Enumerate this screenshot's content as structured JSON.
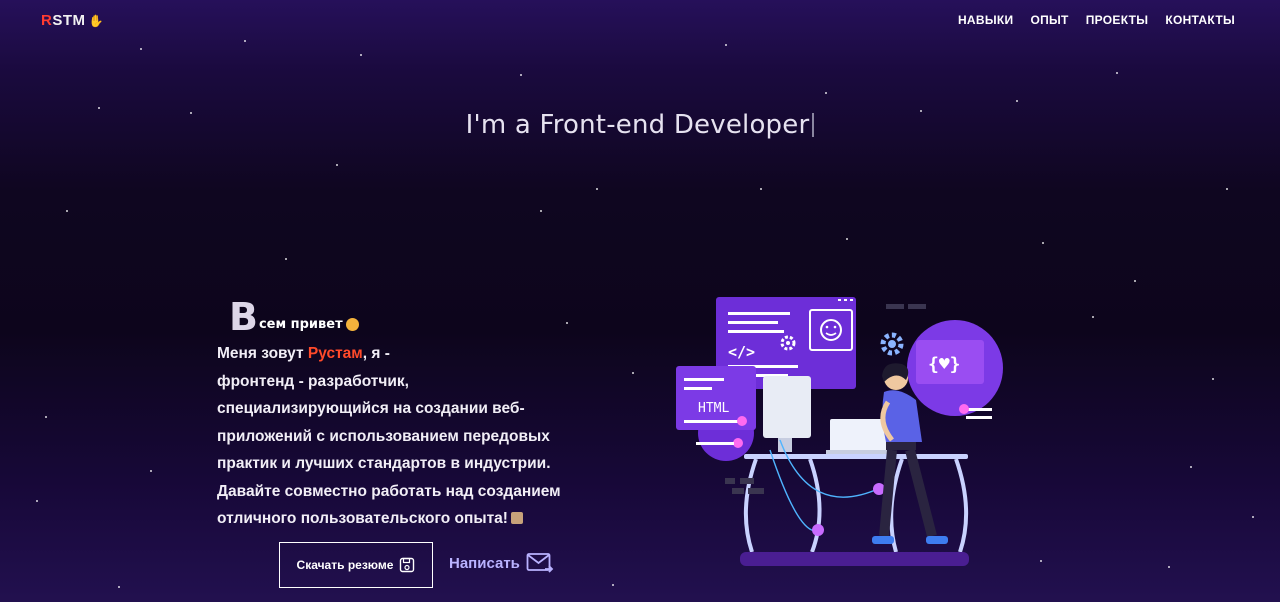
{
  "header": {
    "logo": {
      "accent": "R",
      "rest": "STM",
      "wave_icon": "waving-hand-icon"
    },
    "nav": [
      {
        "label": "НАВЫКИ"
      },
      {
        "label": "ОПЫТ"
      },
      {
        "label": "ПРОЕКТЫ"
      },
      {
        "label": "КОНТАКТЫ"
      }
    ]
  },
  "hero": {
    "headline": "I'm a Front-end Developer",
    "greeting_letter": "В",
    "greeting_rest": "сем привет",
    "bio_prefix": "Меня зовут ",
    "name": "Рустам",
    "bio_suffix": ", я -",
    "bio_lines": [
      "фронтенд - разработчик,",
      "специализирующийся на создании веб-",
      "приложений с использованием передовых",
      "практик и лучших стандартов в индустрии.",
      "Давайте совместно работать над созданием",
      "отличного пользовательского опыта!"
    ],
    "download_button": "Скачать резюме",
    "write_button": "Написать",
    "illustration_labels": {
      "code_tag": "</>",
      "html": "HTML",
      "braces": "{♥}"
    }
  },
  "colors": {
    "accent_red": "#ff3b30",
    "name_orange": "#ff4a2a",
    "link_purple": "#b9b2ff",
    "illus_purple": "#6d2ed8"
  }
}
